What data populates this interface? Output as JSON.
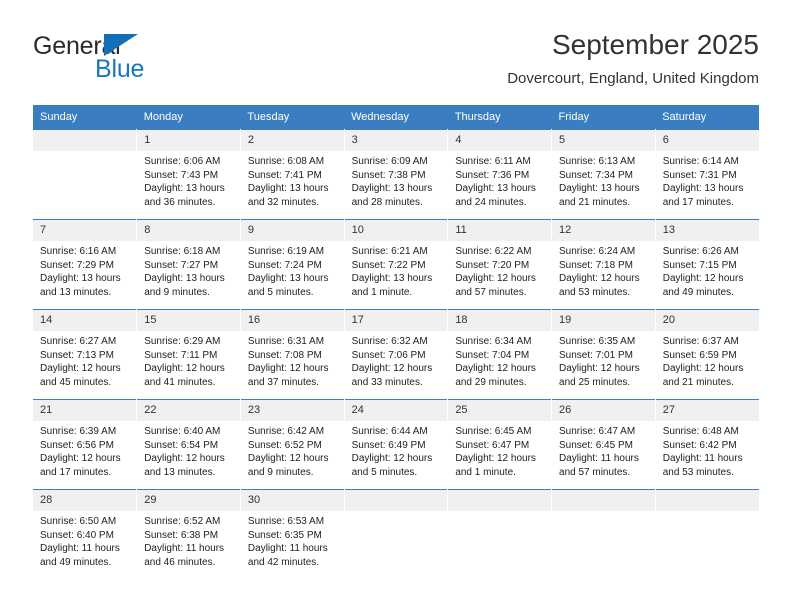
{
  "brand": {
    "name_part1": "General",
    "name_part2": "Blue",
    "accent_color": "#1878be",
    "triangle_color": "#136fb7"
  },
  "header": {
    "title": "September 2025",
    "subtitle": "Dovercourt, England, United Kingdom",
    "header_bg": "#3a7ec1",
    "header_text_color": "#ffffff"
  },
  "weekdays": [
    "Sunday",
    "Monday",
    "Tuesday",
    "Wednesday",
    "Thursday",
    "Friday",
    "Saturday"
  ],
  "weeks": [
    [
      {
        "day": "",
        "sunrise": "",
        "sunset": "",
        "daylight1": "",
        "daylight2": ""
      },
      {
        "day": "1",
        "sunrise": "Sunrise: 6:06 AM",
        "sunset": "Sunset: 7:43 PM",
        "daylight1": "Daylight: 13 hours",
        "daylight2": "and 36 minutes."
      },
      {
        "day": "2",
        "sunrise": "Sunrise: 6:08 AM",
        "sunset": "Sunset: 7:41 PM",
        "daylight1": "Daylight: 13 hours",
        "daylight2": "and 32 minutes."
      },
      {
        "day": "3",
        "sunrise": "Sunrise: 6:09 AM",
        "sunset": "Sunset: 7:38 PM",
        "daylight1": "Daylight: 13 hours",
        "daylight2": "and 28 minutes."
      },
      {
        "day": "4",
        "sunrise": "Sunrise: 6:11 AM",
        "sunset": "Sunset: 7:36 PM",
        "daylight1": "Daylight: 13 hours",
        "daylight2": "and 24 minutes."
      },
      {
        "day": "5",
        "sunrise": "Sunrise: 6:13 AM",
        "sunset": "Sunset: 7:34 PM",
        "daylight1": "Daylight: 13 hours",
        "daylight2": "and 21 minutes."
      },
      {
        "day": "6",
        "sunrise": "Sunrise: 6:14 AM",
        "sunset": "Sunset: 7:31 PM",
        "daylight1": "Daylight: 13 hours",
        "daylight2": "and 17 minutes."
      }
    ],
    [
      {
        "day": "7",
        "sunrise": "Sunrise: 6:16 AM",
        "sunset": "Sunset: 7:29 PM",
        "daylight1": "Daylight: 13 hours",
        "daylight2": "and 13 minutes."
      },
      {
        "day": "8",
        "sunrise": "Sunrise: 6:18 AM",
        "sunset": "Sunset: 7:27 PM",
        "daylight1": "Daylight: 13 hours",
        "daylight2": "and 9 minutes."
      },
      {
        "day": "9",
        "sunrise": "Sunrise: 6:19 AM",
        "sunset": "Sunset: 7:24 PM",
        "daylight1": "Daylight: 13 hours",
        "daylight2": "and 5 minutes."
      },
      {
        "day": "10",
        "sunrise": "Sunrise: 6:21 AM",
        "sunset": "Sunset: 7:22 PM",
        "daylight1": "Daylight: 13 hours",
        "daylight2": "and 1 minute."
      },
      {
        "day": "11",
        "sunrise": "Sunrise: 6:22 AM",
        "sunset": "Sunset: 7:20 PM",
        "daylight1": "Daylight: 12 hours",
        "daylight2": "and 57 minutes."
      },
      {
        "day": "12",
        "sunrise": "Sunrise: 6:24 AM",
        "sunset": "Sunset: 7:18 PM",
        "daylight1": "Daylight: 12 hours",
        "daylight2": "and 53 minutes."
      },
      {
        "day": "13",
        "sunrise": "Sunrise: 6:26 AM",
        "sunset": "Sunset: 7:15 PM",
        "daylight1": "Daylight: 12 hours",
        "daylight2": "and 49 minutes."
      }
    ],
    [
      {
        "day": "14",
        "sunrise": "Sunrise: 6:27 AM",
        "sunset": "Sunset: 7:13 PM",
        "daylight1": "Daylight: 12 hours",
        "daylight2": "and 45 minutes."
      },
      {
        "day": "15",
        "sunrise": "Sunrise: 6:29 AM",
        "sunset": "Sunset: 7:11 PM",
        "daylight1": "Daylight: 12 hours",
        "daylight2": "and 41 minutes."
      },
      {
        "day": "16",
        "sunrise": "Sunrise: 6:31 AM",
        "sunset": "Sunset: 7:08 PM",
        "daylight1": "Daylight: 12 hours",
        "daylight2": "and 37 minutes."
      },
      {
        "day": "17",
        "sunrise": "Sunrise: 6:32 AM",
        "sunset": "Sunset: 7:06 PM",
        "daylight1": "Daylight: 12 hours",
        "daylight2": "and 33 minutes."
      },
      {
        "day": "18",
        "sunrise": "Sunrise: 6:34 AM",
        "sunset": "Sunset: 7:04 PM",
        "daylight1": "Daylight: 12 hours",
        "daylight2": "and 29 minutes."
      },
      {
        "day": "19",
        "sunrise": "Sunrise: 6:35 AM",
        "sunset": "Sunset: 7:01 PM",
        "daylight1": "Daylight: 12 hours",
        "daylight2": "and 25 minutes."
      },
      {
        "day": "20",
        "sunrise": "Sunrise: 6:37 AM",
        "sunset": "Sunset: 6:59 PM",
        "daylight1": "Daylight: 12 hours",
        "daylight2": "and 21 minutes."
      }
    ],
    [
      {
        "day": "21",
        "sunrise": "Sunrise: 6:39 AM",
        "sunset": "Sunset: 6:56 PM",
        "daylight1": "Daylight: 12 hours",
        "daylight2": "and 17 minutes."
      },
      {
        "day": "22",
        "sunrise": "Sunrise: 6:40 AM",
        "sunset": "Sunset: 6:54 PM",
        "daylight1": "Daylight: 12 hours",
        "daylight2": "and 13 minutes."
      },
      {
        "day": "23",
        "sunrise": "Sunrise: 6:42 AM",
        "sunset": "Sunset: 6:52 PM",
        "daylight1": "Daylight: 12 hours",
        "daylight2": "and 9 minutes."
      },
      {
        "day": "24",
        "sunrise": "Sunrise: 6:44 AM",
        "sunset": "Sunset: 6:49 PM",
        "daylight1": "Daylight: 12 hours",
        "daylight2": "and 5 minutes."
      },
      {
        "day": "25",
        "sunrise": "Sunrise: 6:45 AM",
        "sunset": "Sunset: 6:47 PM",
        "daylight1": "Daylight: 12 hours",
        "daylight2": "and 1 minute."
      },
      {
        "day": "26",
        "sunrise": "Sunrise: 6:47 AM",
        "sunset": "Sunset: 6:45 PM",
        "daylight1": "Daylight: 11 hours",
        "daylight2": "and 57 minutes."
      },
      {
        "day": "27",
        "sunrise": "Sunrise: 6:48 AM",
        "sunset": "Sunset: 6:42 PM",
        "daylight1": "Daylight: 11 hours",
        "daylight2": "and 53 minutes."
      }
    ],
    [
      {
        "day": "28",
        "sunrise": "Sunrise: 6:50 AM",
        "sunset": "Sunset: 6:40 PM",
        "daylight1": "Daylight: 11 hours",
        "daylight2": "and 49 minutes."
      },
      {
        "day": "29",
        "sunrise": "Sunrise: 6:52 AM",
        "sunset": "Sunset: 6:38 PM",
        "daylight1": "Daylight: 11 hours",
        "daylight2": "and 46 minutes."
      },
      {
        "day": "30",
        "sunrise": "Sunrise: 6:53 AM",
        "sunset": "Sunset: 6:35 PM",
        "daylight1": "Daylight: 11 hours",
        "daylight2": "and 42 minutes."
      },
      {
        "day": "",
        "sunrise": "",
        "sunset": "",
        "daylight1": "",
        "daylight2": ""
      },
      {
        "day": "",
        "sunrise": "",
        "sunset": "",
        "daylight1": "",
        "daylight2": ""
      },
      {
        "day": "",
        "sunrise": "",
        "sunset": "",
        "daylight1": "",
        "daylight2": ""
      },
      {
        "day": "",
        "sunrise": "",
        "sunset": "",
        "daylight1": "",
        "daylight2": ""
      }
    ]
  ]
}
